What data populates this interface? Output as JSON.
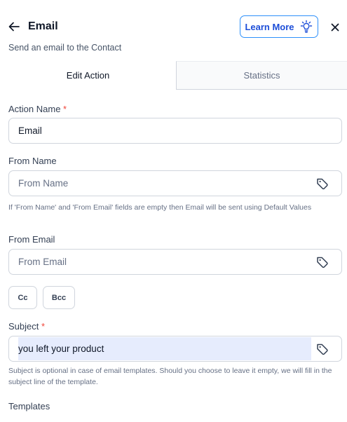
{
  "header": {
    "title": "Email",
    "subtitle": "Send an email to the Contact",
    "learn_more_label": "Learn More"
  },
  "tabs": [
    {
      "label": "Edit Action",
      "active": true
    },
    {
      "label": "Statistics",
      "active": false
    }
  ],
  "form": {
    "action_name": {
      "label": "Action Name",
      "required_mark": "*",
      "value": "Email"
    },
    "from_name": {
      "label": "From Name",
      "placeholder": "From Name",
      "value": ""
    },
    "from_name_help": "If 'From Name' and 'From Email' fields are empty then Email will be sent using Default Values",
    "from_email": {
      "label": "From Email",
      "placeholder": "From Email",
      "value": ""
    },
    "cc_label": "Cc",
    "bcc_label": "Bcc",
    "subject": {
      "label": "Subject",
      "required_mark": "*",
      "value": "you left your product"
    },
    "subject_help": "Subject is optional in case of email templates. Should you choose to leave it empty, we will fill in the subject line of the template.",
    "templates_label": "Templates"
  },
  "colors": {
    "accent": "#2e90fa",
    "required": "#f04438",
    "subject_highlight": "#e6ecfd"
  }
}
